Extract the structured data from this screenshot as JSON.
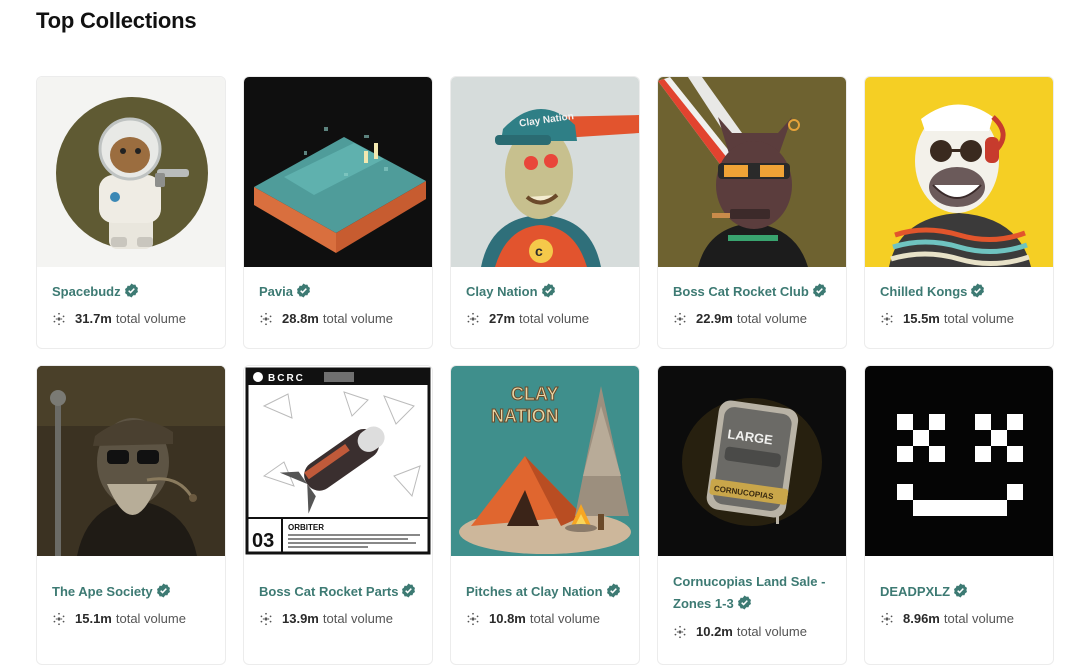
{
  "page": {
    "title": "Top Collections"
  },
  "volume_suffix": "total volume",
  "collections": [
    {
      "name": "Spacebudz",
      "volume": "31.7m"
    },
    {
      "name": "Pavia",
      "volume": "28.8m"
    },
    {
      "name": "Clay Nation",
      "volume": "27m"
    },
    {
      "name": "Boss Cat Rocket Club",
      "volume": "22.9m"
    },
    {
      "name": "Chilled Kongs",
      "volume": "15.5m"
    },
    {
      "name": "The Ape Society",
      "volume": "15.1m"
    },
    {
      "name": "Boss Cat Rocket Parts",
      "volume": "13.9m"
    },
    {
      "name": "Pitches at Clay Nation",
      "volume": "10.8m"
    },
    {
      "name": "Cornucopias Land Sale -",
      "name_line2": "Zones 1-3",
      "volume": "10.2m"
    },
    {
      "name": "DEADPXLZ",
      "volume": "8.96m"
    }
  ],
  "art_text": {
    "clay_cap": "Clay Nation",
    "bcrc_header": "BCRC",
    "bcrc_component": "03",
    "bcrc_title": "ORBITER",
    "clay_nation_logo_1": "CLAY",
    "clay_nation_logo_2": "NATION",
    "cornucopias_box": "LARGE",
    "cornucopias_label": "CORNUCOPIAS"
  }
}
